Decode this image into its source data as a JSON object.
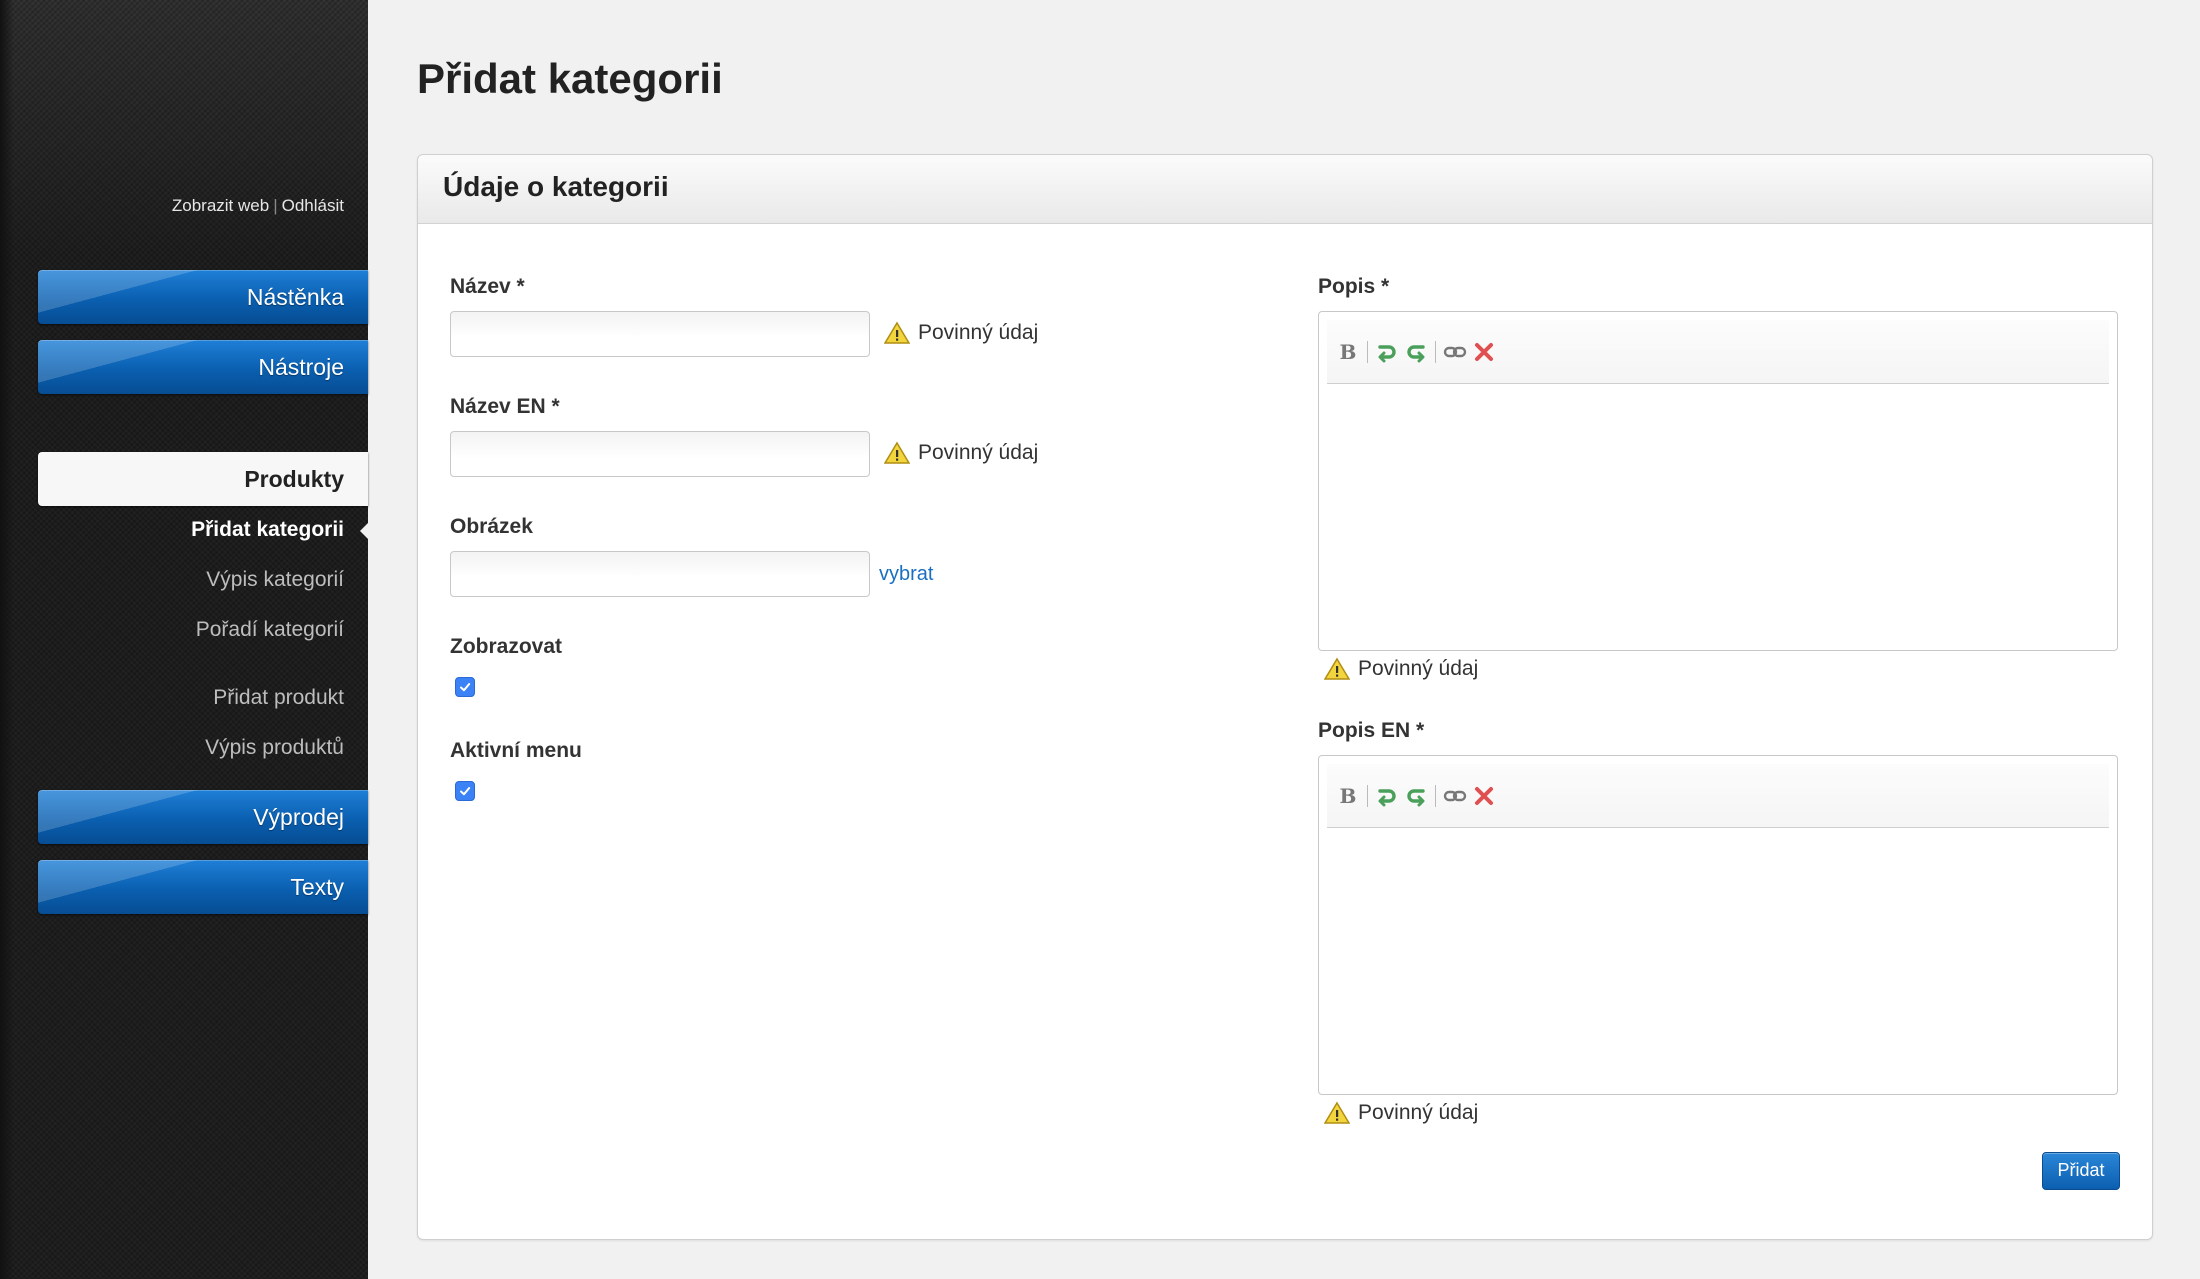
{
  "sidebar": {
    "toplinks": {
      "view_web": "Zobrazit web",
      "separator": "|",
      "logout": "Odhlásit"
    },
    "nav": {
      "dashboard": "Nástěnka",
      "tools": "Nástroje",
      "products": "Produkty",
      "sale": "Výprodej",
      "texts": "Texty"
    },
    "products_sub": {
      "add_category": "Přidat kategorii",
      "list_categories": "Výpis kategorií",
      "order_categories": "Pořadí kategorií",
      "add_product": "Přidat produkt",
      "list_products": "Výpis produktů"
    }
  },
  "page": {
    "title": "Přidat kategorii"
  },
  "panel": {
    "title": "Údaje o kategorii"
  },
  "form": {
    "name": {
      "label": "Název *",
      "value": "",
      "required_msg": "Povinný údaj"
    },
    "name_en": {
      "label": "Název EN *",
      "value": "",
      "required_msg": "Povinný údaj"
    },
    "image": {
      "label": "Obrázek",
      "value": "",
      "choose_link": "vybrat"
    },
    "show": {
      "label": "Zobrazovat",
      "checked": true
    },
    "active_menu": {
      "label": "Aktivní menu",
      "checked": true
    },
    "description": {
      "label": "Popis *",
      "required_msg": "Povinný údaj"
    },
    "description_en": {
      "label": "Popis EN *",
      "required_msg": "Povinný údaj"
    },
    "toolbar_icons": [
      "bold-icon",
      "undo-icon",
      "redo-icon",
      "link-icon",
      "remove-format-icon"
    ],
    "submit_label": "Přidat"
  },
  "colors": {
    "accent": "#0a5fb0",
    "link": "#1a6fc2",
    "checkbox": "#3b82f6"
  }
}
